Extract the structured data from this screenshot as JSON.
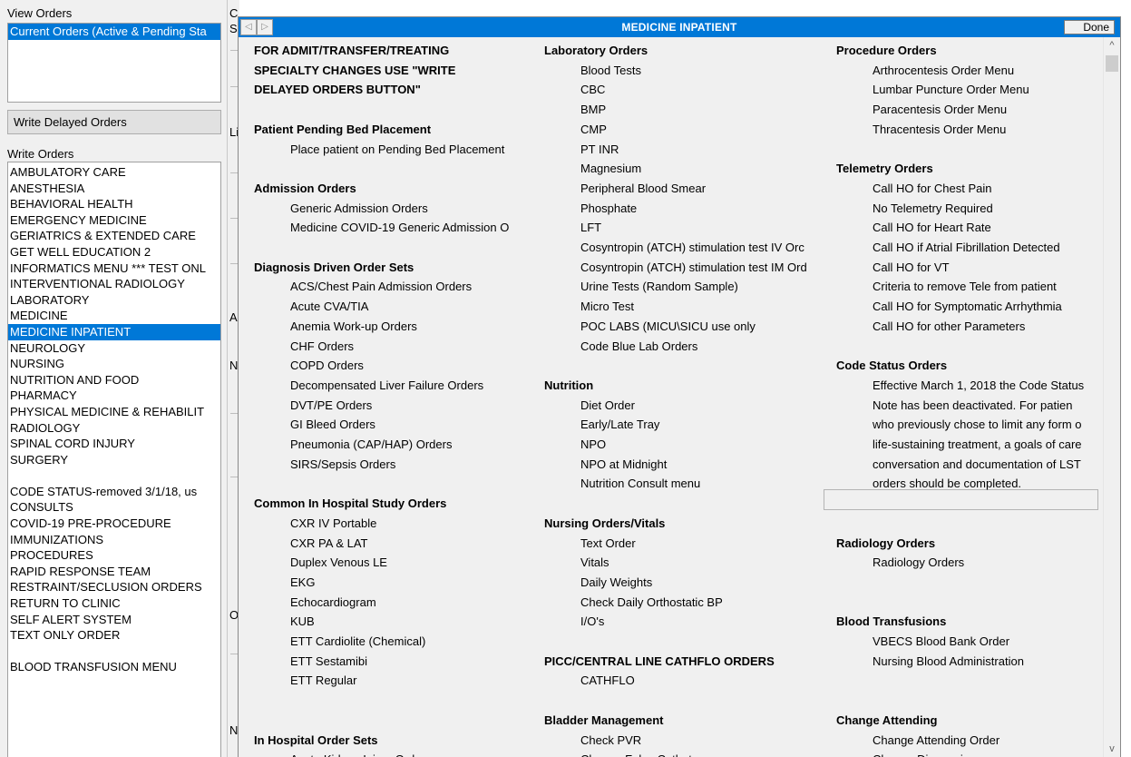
{
  "left": {
    "view_orders_label": "View Orders",
    "view_orders_selected": "Current Orders (Active & Pending Sta",
    "write_delayed_label": "Write Delayed Orders",
    "write_orders_label": "Write Orders",
    "write_orders_items": [
      "AMBULATORY CARE",
      "ANESTHESIA",
      "BEHAVIORAL HEALTH",
      "EMERGENCY MEDICINE",
      "GERIATRICS & EXTENDED CARE",
      "GET WELL EDUCATION 2",
      "INFORMATICS MENU *** TEST ONL",
      "INTERVENTIONAL RADIOLOGY",
      "LABORATORY",
      "MEDICINE",
      "MEDICINE INPATIENT",
      "NEUROLOGY",
      "NURSING",
      "NUTRITION AND FOOD",
      "PHARMACY",
      "PHYSICAL MEDICINE & REHABILIT",
      "RADIOLOGY",
      "SPINAL CORD INJURY",
      "SURGERY",
      "",
      "CODE STATUS-removed 3/1/18, us",
      "CONSULTS",
      "COVID-19 PRE-PROCEDURE",
      "IMMUNIZATIONS",
      "PROCEDURES",
      "RAPID RESPONSE TEAM",
      "RESTRAINT/SECLUSION ORDERS",
      "RETURN TO CLINIC",
      "SELF ALERT SYSTEM",
      "TEXT ONLY ORDER",
      "",
      "BLOOD TRANSFUSION MENU"
    ],
    "selected_index": 10
  },
  "middle": {
    "letters": [
      "C",
      "S",
      "Li",
      "A",
      "N",
      "O",
      "N"
    ]
  },
  "panel": {
    "title": "MEDICINE INPATIENT",
    "done_label": "Done",
    "back_glyph": "◁",
    "forward_glyph": "▷",
    "scroll_up_glyph": "^",
    "scroll_down_glyph": "v",
    "col1": [
      {
        "t": "FOR ADMIT/TRANSFER/TREATING",
        "h": true
      },
      {
        "t": "SPECIALTY CHANGES USE \"WRITE",
        "h": true
      },
      {
        "t": "DELAYED ORDERS BUTTON\"",
        "h": true
      },
      {
        "t": ""
      },
      {
        "t": "Patient Pending Bed Placement",
        "h": true
      },
      {
        "t": "Place patient on Pending Bed Placement"
      },
      {
        "t": ""
      },
      {
        "t": "Admission Orders",
        "h": true
      },
      {
        "t": "Generic Admission Orders"
      },
      {
        "t": "Medicine COVID-19 Generic Admission O"
      },
      {
        "t": ""
      },
      {
        "t": "Diagnosis Driven Order Sets",
        "h": true
      },
      {
        "t": "ACS/Chest Pain Admission Orders"
      },
      {
        "t": "Acute CVA/TIA"
      },
      {
        "t": "Anemia Work-up Orders"
      },
      {
        "t": "CHF Orders"
      },
      {
        "t": "COPD Orders"
      },
      {
        "t": "Decompensated Liver Failure Orders"
      },
      {
        "t": "DVT/PE Orders"
      },
      {
        "t": "GI Bleed Orders"
      },
      {
        "t": "Pneumonia (CAP/HAP) Orders"
      },
      {
        "t": "SIRS/Sepsis Orders"
      },
      {
        "t": ""
      },
      {
        "t": "Common In Hospital Study Orders",
        "h": true
      },
      {
        "t": "CXR IV Portable"
      },
      {
        "t": "CXR PA & LAT"
      },
      {
        "t": "Duplex Venous LE"
      },
      {
        "t": "EKG"
      },
      {
        "t": "Echocardiogram"
      },
      {
        "t": "KUB"
      },
      {
        "t": "ETT Cardiolite (Chemical)"
      },
      {
        "t": "ETT Sestamibi"
      },
      {
        "t": "ETT Regular"
      },
      {
        "t": ""
      },
      {
        "t": ""
      },
      {
        "t": "In Hospital Order Sets",
        "h": true
      },
      {
        "t": "Acute Kidney Injury Orders"
      }
    ],
    "col2": [
      {
        "t": "Laboratory Orders",
        "h": true
      },
      {
        "t": "Blood Tests"
      },
      {
        "t": "CBC"
      },
      {
        "t": "BMP"
      },
      {
        "t": "CMP"
      },
      {
        "t": "PT INR"
      },
      {
        "t": "Magnesium"
      },
      {
        "t": "Peripheral Blood Smear"
      },
      {
        "t": "Phosphate"
      },
      {
        "t": "LFT"
      },
      {
        "t": "Cosyntropin (ATCH) stimulation test IV Orc"
      },
      {
        "t": "Cosyntropin (ATCH) stimulation test IM Ord"
      },
      {
        "t": "Urine Tests (Random Sample)"
      },
      {
        "t": "Micro Test"
      },
      {
        "t": "POC LABS (MICU\\SICU use only"
      },
      {
        "t": "Code Blue Lab Orders"
      },
      {
        "t": ""
      },
      {
        "t": "Nutrition",
        "h": true
      },
      {
        "t": "Diet Order"
      },
      {
        "t": "Early/Late Tray"
      },
      {
        "t": "NPO"
      },
      {
        "t": "NPO at Midnight"
      },
      {
        "t": "Nutrition Consult menu"
      },
      {
        "t": ""
      },
      {
        "t": "Nursing Orders/Vitals",
        "h": true
      },
      {
        "t": "Text Order"
      },
      {
        "t": "Vitals"
      },
      {
        "t": "Daily Weights"
      },
      {
        "t": "Check Daily Orthostatic BP"
      },
      {
        "t": "I/O's"
      },
      {
        "t": ""
      },
      {
        "t": "PICC/CENTRAL LINE CATHFLO ORDERS",
        "h": true
      },
      {
        "t": "CATHFLO"
      },
      {
        "t": ""
      },
      {
        "t": "Bladder Management",
        "h": true
      },
      {
        "t": "Check PVR"
      },
      {
        "t": "Change Foley Catheter"
      }
    ],
    "col3": [
      {
        "t": "Procedure Orders",
        "h": true
      },
      {
        "t": "Arthrocentesis Order Menu"
      },
      {
        "t": "Lumbar Puncture Order Menu"
      },
      {
        "t": "Paracentesis Order Menu"
      },
      {
        "t": "Thracentesis Order Menu"
      },
      {
        "t": ""
      },
      {
        "t": "Telemetry Orders",
        "h": true
      },
      {
        "t": "Call HO for Chest Pain"
      },
      {
        "t": "No Telemetry Required"
      },
      {
        "t": "Call HO for Heart Rate"
      },
      {
        "t": "Call HO if Atrial Fibrillation Detected"
      },
      {
        "t": "Call HO for VT"
      },
      {
        "t": "Criteria to remove Tele from patient"
      },
      {
        "t": "Call HO for Symptomatic Arrhythmia"
      },
      {
        "t": "Call HO for other Parameters"
      },
      {
        "t": ""
      },
      {
        "t": "Code Status Orders",
        "h": true
      },
      {
        "t": "Effective March 1, 2018 the Code Status"
      },
      {
        "t": "Note has been deactivated. For patien"
      },
      {
        "t": "who previously chose to limit any form o"
      },
      {
        "t": "life-sustaining treatment, a goals of care"
      },
      {
        "t": "conversation and documentation of LST"
      },
      {
        "t": "orders should be completed."
      },
      {
        "t": ""
      },
      {
        "t": ""
      },
      {
        "t": "Radiology Orders",
        "h": true
      },
      {
        "t": "Radiology Orders"
      },
      {
        "t": ""
      },
      {
        "t": ""
      },
      {
        "t": "Blood Transfusions",
        "h": true
      },
      {
        "t": "VBECS Blood Bank Order"
      },
      {
        "t": "Nursing Blood Administration"
      },
      {
        "t": ""
      },
      {
        "t": ""
      },
      {
        "t": "Change Attending",
        "h": true
      },
      {
        "t": "Change Attending Order"
      },
      {
        "t": "Change Diagnosis"
      }
    ]
  }
}
